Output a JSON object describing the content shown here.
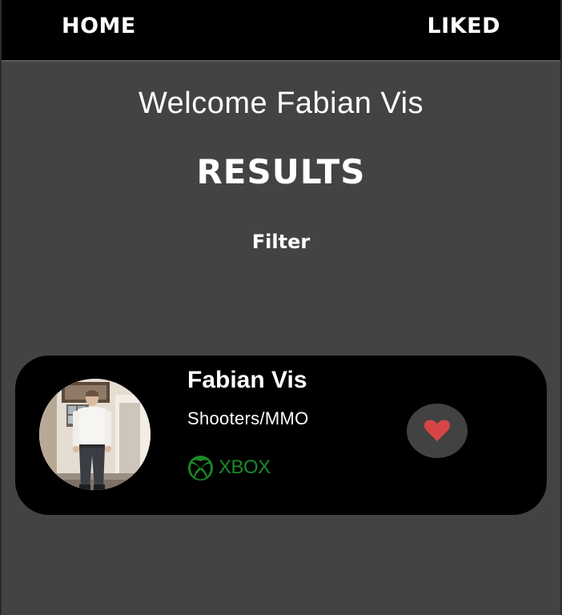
{
  "nav": {
    "home_label": "HOME",
    "liked_label": "LIKED"
  },
  "welcome": {
    "text": "Welcome Fabian Vis"
  },
  "results": {
    "title": "RESULTS",
    "filter_label": "Filter"
  },
  "cards": [
    {
      "name": "Fabian Vis",
      "genre": "Shooters/MMO",
      "platform_label": "XBOX",
      "platform_icon": "xbox-logo-icon",
      "like_icon": "heart-icon"
    }
  ],
  "colors": {
    "background": "#434343",
    "topbar": "#000000",
    "card": "#000000",
    "heart": "#d64545",
    "xbox_green": "#1c8a29",
    "like_button": "#424242"
  }
}
